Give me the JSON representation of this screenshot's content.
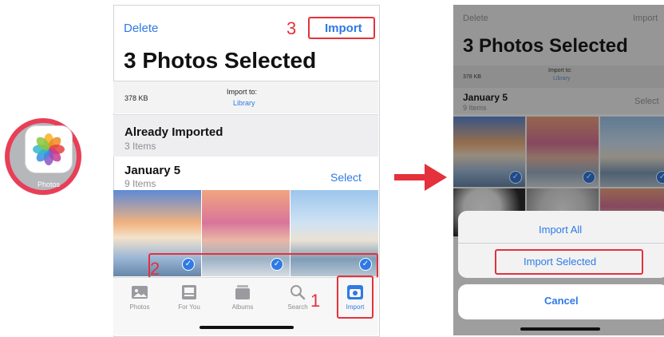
{
  "app_icon": {
    "name": "Photos",
    "ring_color": "#e93e57"
  },
  "colors": {
    "accent": "#2f7ae5",
    "annotation": "#e4313b"
  },
  "phone1": {
    "delete_label": "Delete",
    "import_label": "Import",
    "title": "3 Photos Selected",
    "size": "378 KB",
    "import_to_label": "Import to:",
    "import_to_value": "Library",
    "already_imported": {
      "title": "Already Imported",
      "subtitle": "3 Items"
    },
    "group": {
      "date": "January 5",
      "count": "9 Items",
      "select_label": "Select"
    },
    "photos_selected": 3,
    "tabs": [
      {
        "label": "Photos",
        "icon": "photos-tab-icon"
      },
      {
        "label": "For You",
        "icon": "for-you-tab-icon"
      },
      {
        "label": "Albums",
        "icon": "albums-tab-icon"
      },
      {
        "label": "Search",
        "icon": "search-icon"
      },
      {
        "label": "Import",
        "icon": "import-camera-icon",
        "active": true
      }
    ],
    "steps": {
      "tab": "1",
      "checkmarks": "2",
      "import_button": "3"
    }
  },
  "phone2": {
    "delete_label": "Delete",
    "import_label": "Import",
    "title": "3 Photos Selected",
    "size": "378 KB",
    "import_to_label": "Import to:",
    "import_to_value": "Library",
    "group": {
      "date": "January 5",
      "count": "9 Items",
      "select_label": "Select"
    },
    "sheet": {
      "import_all": "Import All",
      "import_selected": "Import Selected",
      "cancel": "Cancel"
    }
  }
}
